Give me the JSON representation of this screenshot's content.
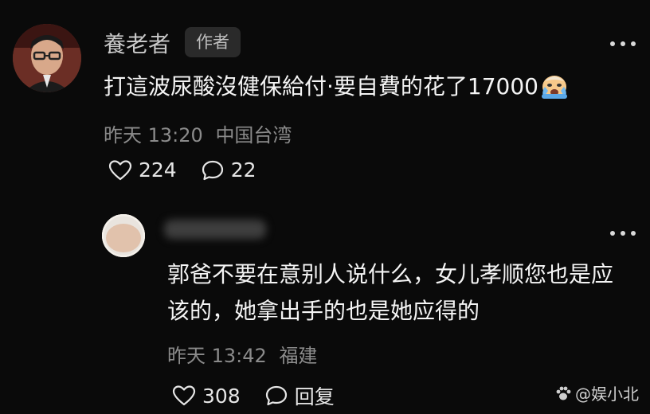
{
  "comments": [
    {
      "username": "養老者",
      "badge": "作者",
      "text": "打這波尿酸沒健保給付·要自費的花了17000",
      "emoji": "crying-face-icon",
      "date": "昨天 13:20",
      "location": "中国台湾",
      "likes": "224",
      "replies": "22"
    },
    {
      "username": "",
      "text": "郭爸不要在意别人说什么，女儿孝顺您也是应该的，她拿出手的也是她应得的",
      "date": "昨天 13:42",
      "location": "福建",
      "likes": "308",
      "reply_label": "回复"
    }
  ],
  "watermark": "@娱小北",
  "colors": {
    "background": "#0a0a0a",
    "meta": "#8b8b8b",
    "badge_bg": "#2a2a2a"
  }
}
